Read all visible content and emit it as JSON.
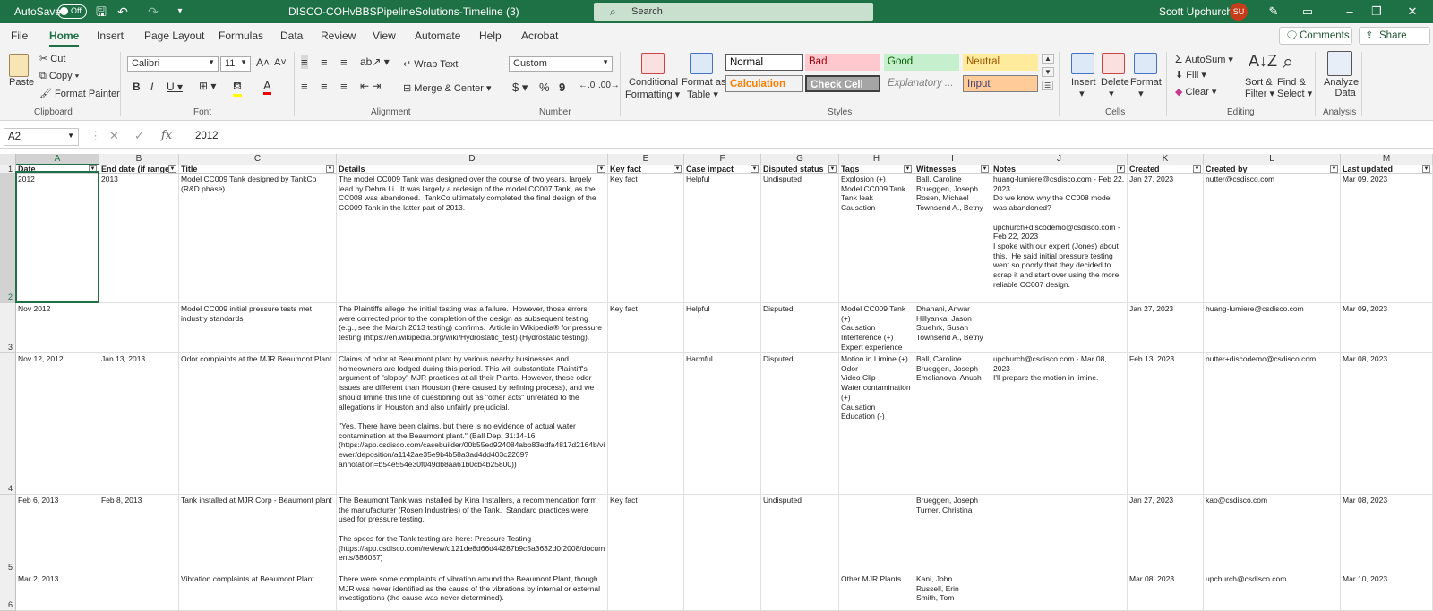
{
  "titlebar": {
    "autosave": "AutoSave",
    "toggle": "Off",
    "filename": "DISCO-COHvBBSPipelineSolutions-Timeline (3)",
    "search_placeholder": "Search",
    "user": "Scott Upchurch",
    "initials": "SU"
  },
  "menu": [
    "File",
    "Home",
    "Insert",
    "Page Layout",
    "Formulas",
    "Data",
    "Review",
    "View",
    "Automate",
    "Help",
    "Acrobat"
  ],
  "ribbon_buttons": {
    "comments": "Comments",
    "share": "Share"
  },
  "clipboard": {
    "paste": "Paste",
    "cut": "Cut",
    "copy": "Copy",
    "format_painter": "Format Painter",
    "label": "Clipboard"
  },
  "font": {
    "name": "Calibri",
    "size": "11",
    "label": "Font"
  },
  "alignment": {
    "wrap": "Wrap Text",
    "merge": "Merge & Center",
    "label": "Alignment"
  },
  "number": {
    "format": "Custom",
    "label": "Number"
  },
  "styles": {
    "conditional": "Conditional",
    "formatting": "Formatting",
    "format_as": "Format as",
    "table": "Table",
    "normal": "Normal",
    "bad": "Bad",
    "good": "Good",
    "neutral": "Neutral",
    "calculation": "Calculation",
    "check": "Check Cell",
    "explanatory": "Explanatory ...",
    "input": "Input",
    "label": "Styles"
  },
  "cells": {
    "insert": "Insert",
    "delete": "Delete",
    "format": "Format",
    "label": "Cells"
  },
  "editing": {
    "autosum": "AutoSum",
    "fill": "Fill",
    "clear": "Clear",
    "sort": "Sort &",
    "filter": "Filter",
    "find": "Find &",
    "select": "Select",
    "label": "Editing"
  },
  "analysis": {
    "analyze": "Analyze",
    "data": "Data",
    "label": "Analysis"
  },
  "formula_bar": {
    "namebox": "A2",
    "value": "2012"
  },
  "columns": [
    {
      "letter": "A",
      "header": "Date"
    },
    {
      "letter": "B",
      "header": "End date (if range)"
    },
    {
      "letter": "C",
      "header": "Title"
    },
    {
      "letter": "D",
      "header": "Details"
    },
    {
      "letter": "E",
      "header": "Key fact"
    },
    {
      "letter": "F",
      "header": "Case impact"
    },
    {
      "letter": "G",
      "header": "Disputed status"
    },
    {
      "letter": "H",
      "header": "Tags"
    },
    {
      "letter": "I",
      "header": "Witnesses"
    },
    {
      "letter": "J",
      "header": "Notes"
    },
    {
      "letter": "K",
      "header": "Created"
    },
    {
      "letter": "L",
      "header": "Created by"
    },
    {
      "letter": "M",
      "header": "Last updated"
    }
  ],
  "rows": [
    {
      "num": "2",
      "cells": [
        "2012",
        "2013",
        "Model CC009 Tank designed by TankCo (R&D phase)",
        "The model CC009 Tank was designed over the course of two years, largely lead by Debra Li.  It was largely a redesign of the model CC007 Tank, as the CC008 was abandoned.  TankCo ultimately completed the final design of the CC009 Tank in the latter part of 2013.",
        "Key fact",
        "Helpful",
        "Undisputed",
        "Explosion (+)\nModel CC009 Tank\nTank leak\nCausation",
        "Ball, Caroline\nBrueggen, Joseph\nRosen, Michael\nTownsend A., Betny",
        "huang-lumiere@csdisco.com - Feb 22, 2023\nDo we know why the CC008 model was abandoned?\n\nupchurch+discodemo@csdisco.com - Feb 22, 2023\nI spoke with our expert (Jones) about this.  He said initial pressure testing went so poorly that they decided to scrap it and start over using the more reliable CC007 design.",
        "Jan 27, 2023",
        "nutter@csdisco.com",
        "Mar 09, 2023"
      ]
    },
    {
      "num": "3",
      "cells": [
        "Nov 2012",
        "",
        "Model CC009 initial pressure tests met industry standards",
        "The Plaintiffs allege the initial testing was a failure.  However, those errors were corrected prior to the completion of the design as subsequent testing (e.g., see the March 2013 testing) confirms.  Article in Wikipedia® for pressure testing (https://en.wikipedia.org/wiki/Hydrostatic_test) (Hydrostatic testing).",
        "Key fact",
        "Helpful",
        "Disputed",
        "Model CC009 Tank (+)\nCausation\nInterference (+)\nExpert experience",
        "Dhanani, Anwar\nHillyanka, Jason\nStuehrk, Susan\nTownsend A., Betny",
        "",
        "Jan 27, 2023",
        "huang-lumiere@csdisco.com",
        "Mar 09, 2023"
      ]
    },
    {
      "num": "4",
      "cells": [
        "Nov 12, 2012",
        "Jan 13, 2013",
        "Odor complaints at the MJR Beaumont Plant",
        "Claims of odor at Beaumont plant by various nearby businesses and homeowners are lodged during this period. This will substantiate Plaintiff's argument of \"sloppy\" MJR practices at all their Plants. However, these odor issues are different than Houston (here caused by refining process), and we should limine this line of questioning out as \"other acts\" unrelated to the allegations in Houston and also unfairly prejudicial.\n\n\"Yes. There have been claims, but there is no evidence of actual water contamination at the Beaumont plant.\" (Ball Dep. 31:14-16 (https://app.csdisco.com/casebuilder/00b55ed924084abb83edfa4817d2164b/viewer/deposition/a1142ae35e9b4b58a3ad4dd403c2209?annotation=b54e554e30f049db8aa61b0cb4b25800))",
        "",
        "Harmful",
        "Disputed",
        "Motion in Limine (+)\nOdor\nVideo Clip\nWater contamination (+)\nCausation\nEducation (-)",
        "Ball, Caroline\nBrueggen, Joseph\nEmelianova, Anush",
        "upchurch@csdisco.com - Mar 08, 2023\nI'll prepare the motion in limine.",
        "Feb 13, 2023",
        "nutter+discodemo@csdisco.com",
        "Mar 08, 2023"
      ]
    },
    {
      "num": "5",
      "cells": [
        "Feb 6, 2013",
        "Feb 8, 2013",
        "Tank installed at MJR Corp - Beaumont plant",
        "The Beaumont Tank was installed by Kina Installers, a recommendation form the manufacturer (Rosen Industries) of the Tank.  Standard practices were used for pressure testing.\n\nThe specs for the Tank testing are here: Pressure Testing (https://app.csdisco.com/review/d121de8d66d44287b9c5a3632d0f2008/documents/386057)",
        "Key fact",
        "",
        "Undisputed",
        "",
        "Brueggen, Joseph\nTurner, Christina",
        "",
        "Jan 27, 2023",
        "kao@csdisco.com",
        "Mar 08, 2023"
      ]
    },
    {
      "num": "6",
      "cells": [
        "Mar 2, 2013",
        "",
        "Vibration complaints at Beaumont Plant",
        "There were some complaints of vibration around the Beaumont Plant, though MJR was never identified as the cause of the vibrations by internal or external investigations (the cause was never determined).",
        "",
        "",
        "",
        "Other MJR Plants",
        "Kani, John\nRussell, Erin\nSmith, Tom",
        "",
        "Mar 08, 2023",
        "upchurch@csdisco.com",
        "Mar 10, 2023"
      ]
    }
  ]
}
